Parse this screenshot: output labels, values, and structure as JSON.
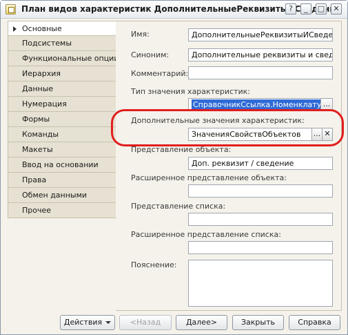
{
  "window": {
    "title": "План видов характеристик ДополнительныеРеквизитыИСведения",
    "controls": {
      "help": "?",
      "minimize": "_",
      "maximize": "□",
      "close": "✕"
    }
  },
  "tabs": [
    {
      "label": "Основные",
      "active": true
    },
    {
      "label": "Подсистемы"
    },
    {
      "label": "Функциональные опции"
    },
    {
      "label": "Иерархия"
    },
    {
      "label": "Данные"
    },
    {
      "label": "Нумерация"
    },
    {
      "label": "Формы"
    },
    {
      "label": "Команды"
    },
    {
      "label": "Макеты"
    },
    {
      "label": "Ввод на основании"
    },
    {
      "label": "Права"
    },
    {
      "label": "Обмен данными"
    },
    {
      "label": "Прочее"
    }
  ],
  "form": {
    "name": {
      "label": "Имя:",
      "value": "ДополнительныеРеквизитыИСведения"
    },
    "synonym": {
      "label": "Синоним:",
      "value": "Дополнительные реквизиты и сведения"
    },
    "comment": {
      "label": "Комментарий:",
      "value": ""
    },
    "value_type": {
      "label": "Тип значения характеристик:",
      "value": "СправочникСсылка.Номенклатура, П"
    },
    "additional_values": {
      "label": "Дополнительные значения характеристик:",
      "value": "ЗначенияСвойствОбъектов"
    },
    "object_presentation": {
      "label": "Представление объекта:",
      "value": "Доп. реквизит / сведение"
    },
    "extended_object_presentation": {
      "label": "Расширенное представление объекта:",
      "value": ""
    },
    "list_presentation": {
      "label": "Представление списка:",
      "value": ""
    },
    "extended_list_presentation": {
      "label": "Расширенное представление списка:",
      "value": ""
    },
    "explanation": {
      "label": "Пояснение:",
      "value": ""
    },
    "ellipsis": "...",
    "clear": "✕"
  },
  "accent_color": "#e21d1d",
  "buttons": {
    "actions": "Действия",
    "back": "<Назад",
    "next": "Далее>",
    "close": "Закрыть",
    "help": "Справка"
  }
}
